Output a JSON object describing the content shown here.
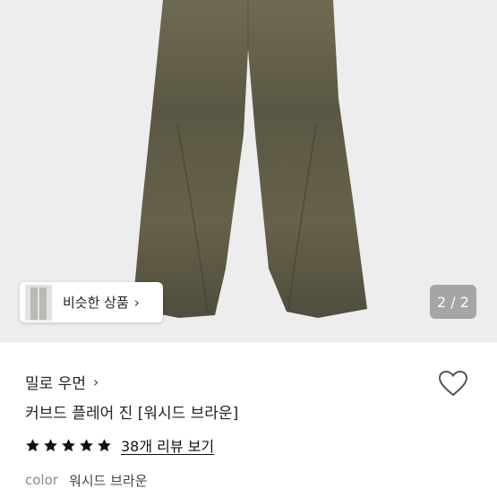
{
  "gallery": {
    "similar_label": "비슷한 상품",
    "chevron": "›",
    "pager": "2 / 2"
  },
  "product": {
    "store_name": "밀로 우먼",
    "store_chevron": "›",
    "title": "커브드 플레어 진 [워시드 브라운]",
    "rating": 5,
    "review_link": "38개 리뷰 보기",
    "option_key": "color",
    "option_value": "워시드 브라운"
  },
  "colors": {
    "image_bg": "#ededed",
    "jeans": "#5d5a45",
    "star": "#111111",
    "heart_outline": "#555555"
  },
  "icons": [
    "chevron-right-icon",
    "heart-icon",
    "star-icon"
  ]
}
